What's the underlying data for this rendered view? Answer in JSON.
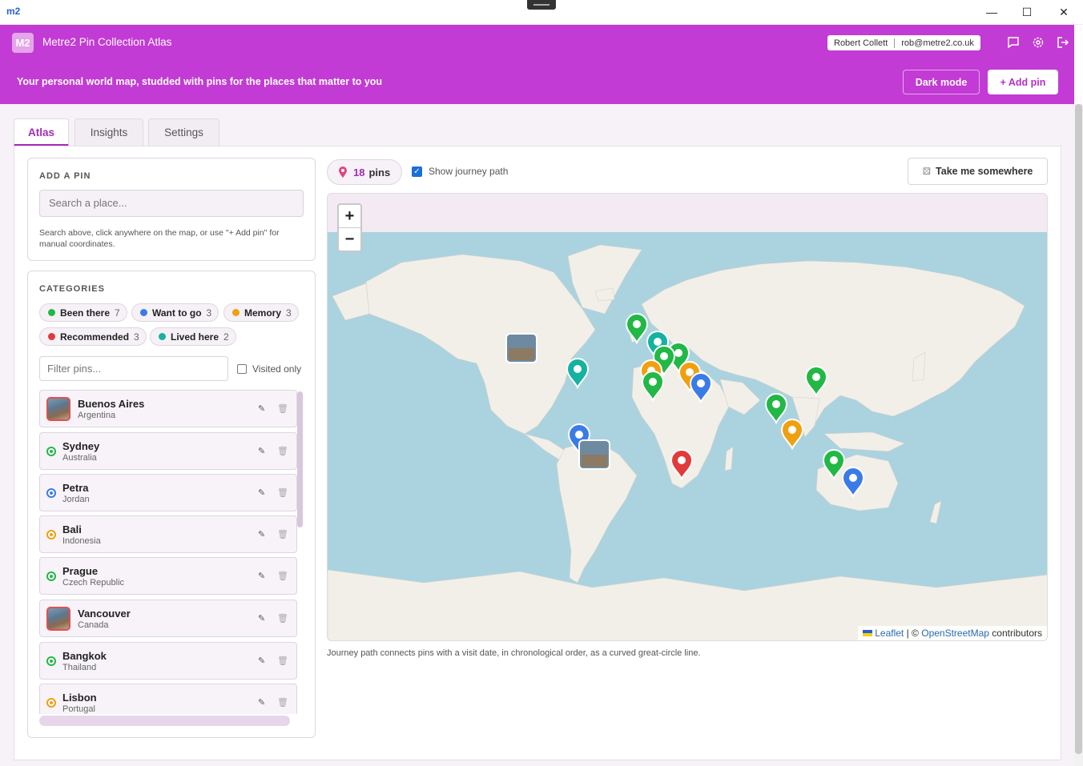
{
  "window": {
    "logo": "m2",
    "minimize_glyph": "—",
    "maximize_glyph": "☐",
    "close_glyph": "✕"
  },
  "header": {
    "badge": "M2",
    "title": "Metre2 Pin Collection Atlas",
    "user_name": "Robert Collett",
    "user_email": "rob@metre2.co.uk",
    "tagline": "Your personal world map, studded with pins for the places that matter to you",
    "dark_mode_label": "Dark mode",
    "add_pin_label": "+ Add pin",
    "icons": [
      "chat-icon",
      "gear-icon",
      "logout-icon"
    ]
  },
  "tabs": [
    {
      "label": "Atlas",
      "active": true
    },
    {
      "label": "Insights",
      "active": false
    },
    {
      "label": "Settings",
      "active": false
    }
  ],
  "add_pin": {
    "title": "ADD A PIN",
    "search_placeholder": "Search a place...",
    "hint": "Search above, click anywhere on the map, or use \"+ Add pin\" for manual coordinates."
  },
  "categories": {
    "title": "CATEGORIES",
    "items": [
      {
        "label": "Been there",
        "count": "7",
        "color": "#22b845"
      },
      {
        "label": "Want to go",
        "count": "3",
        "color": "#3b7be8"
      },
      {
        "label": "Memory",
        "count": "3",
        "color": "#f0a00e"
      },
      {
        "label": "Recommended",
        "count": "3",
        "color": "#e23a3a"
      },
      {
        "label": "Lived here",
        "count": "2",
        "color": "#14b2a0"
      }
    ],
    "filter_placeholder": "Filter pins...",
    "visited_only_label": "Visited only"
  },
  "pins": [
    {
      "name": "Buenos Aires",
      "country": "Argentina",
      "kind": "photo",
      "color": "#e05050"
    },
    {
      "name": "Sydney",
      "country": "Australia",
      "kind": "marker",
      "color": "#22b845"
    },
    {
      "name": "Petra",
      "country": "Jordan",
      "kind": "marker",
      "color": "#3b7be8"
    },
    {
      "name": "Bali",
      "country": "Indonesia",
      "kind": "marker",
      "color": "#f0a00e"
    },
    {
      "name": "Prague",
      "country": "Czech Republic",
      "kind": "marker",
      "color": "#22b845"
    },
    {
      "name": "Vancouver",
      "country": "Canada",
      "kind": "photo",
      "color": "#e05050"
    },
    {
      "name": "Bangkok",
      "country": "Thailand",
      "kind": "marker",
      "color": "#22b845"
    },
    {
      "name": "Lisbon",
      "country": "Portugal",
      "kind": "marker",
      "color": "#f0a00e"
    }
  ],
  "map": {
    "pin_count": "18",
    "pin_word": "pins",
    "journey_label": "Show journey path",
    "take_me_label": "Take me somewhere",
    "zoom_in": "+",
    "zoom_out": "−",
    "attribution_leaflet": "Leaflet",
    "attribution_sep": "| ©",
    "attribution_osm": "OpenStreetMap",
    "attribution_tail": "contributors",
    "caption": "Journey path connects pins with a visit date, in chronological order, as a curved great-circle line.",
    "sea_color": "#aad3df",
    "land_color": "#f2efe9"
  }
}
